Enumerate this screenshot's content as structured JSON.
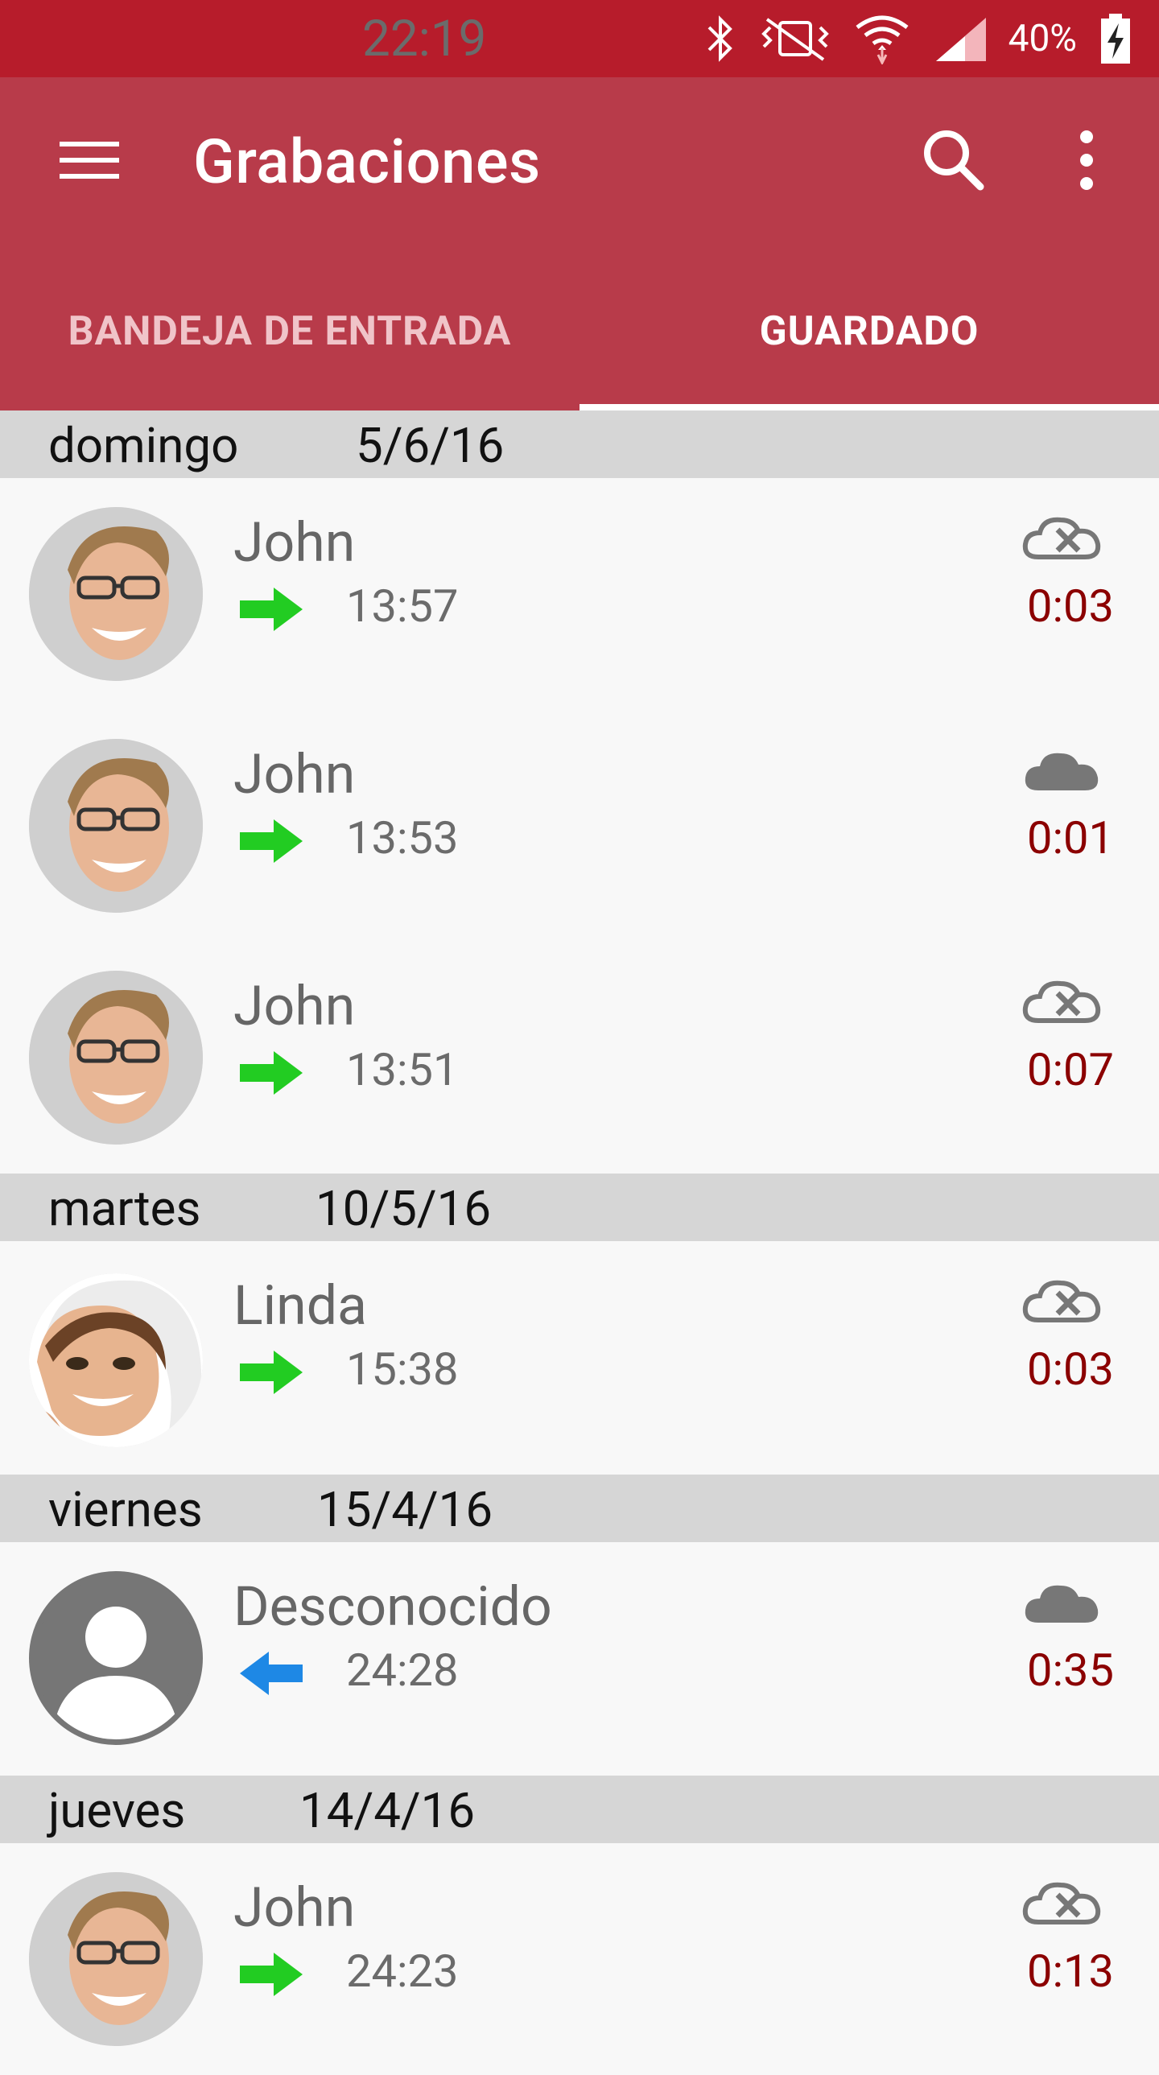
{
  "status_bar": {
    "battery_percent": "40%",
    "time": "22:19",
    "icons": [
      "bluetooth-icon",
      "vibrate-icon",
      "wifi-icon",
      "signal-icon",
      "battery-charging-icon"
    ]
  },
  "app_bar": {
    "title": "Grabaciones",
    "icons": [
      "menu-icon",
      "search-icon",
      "more-vert-icon"
    ],
    "color": "#b83b4a"
  },
  "tabs": [
    {
      "label": "BANDEJA DE ENTRADA",
      "selected": false
    },
    {
      "label": "GUARDADO",
      "selected": true
    }
  ],
  "sections": [
    {
      "day": "domingo",
      "date": "5/6/16",
      "items": [
        {
          "name": "John",
          "direction": "outgoing",
          "time": "13:57",
          "cloud": "cloud-off-icon",
          "duration": "0:03"
        },
        {
          "name": "John",
          "direction": "outgoing",
          "time": "13:53",
          "cloud": "cloud-icon",
          "duration": "0:01"
        },
        {
          "name": "John",
          "direction": "outgoing",
          "time": "13:51",
          "cloud": "cloud-off-icon",
          "duration": "0:07"
        }
      ]
    },
    {
      "day": "martes",
      "date": "10/5/16",
      "items": [
        {
          "name": "Linda",
          "direction": "outgoing",
          "time": "15:38",
          "cloud": "cloud-off-icon",
          "duration": "0:03"
        }
      ]
    },
    {
      "day": "viernes",
      "date": "15/4/16",
      "items": [
        {
          "name": "Desconocido",
          "direction": "incoming",
          "time": "24:28",
          "cloud": "cloud-icon",
          "duration": "0:35"
        }
      ]
    },
    {
      "day": "jueves",
      "date": "14/4/16",
      "items": [
        {
          "name": "John",
          "direction": "outgoing",
          "time": "24:23",
          "cloud": "cloud-off-icon",
          "duration": "0:13"
        }
      ]
    }
  ],
  "colors": {
    "status_bar": "#b71c2b",
    "app_bar": "#b83b4a",
    "section_header": "#d6d6d6",
    "duration": "#8b0000",
    "outgoing_arrow": "#22cc22",
    "incoming_arrow": "#1e88e5"
  }
}
